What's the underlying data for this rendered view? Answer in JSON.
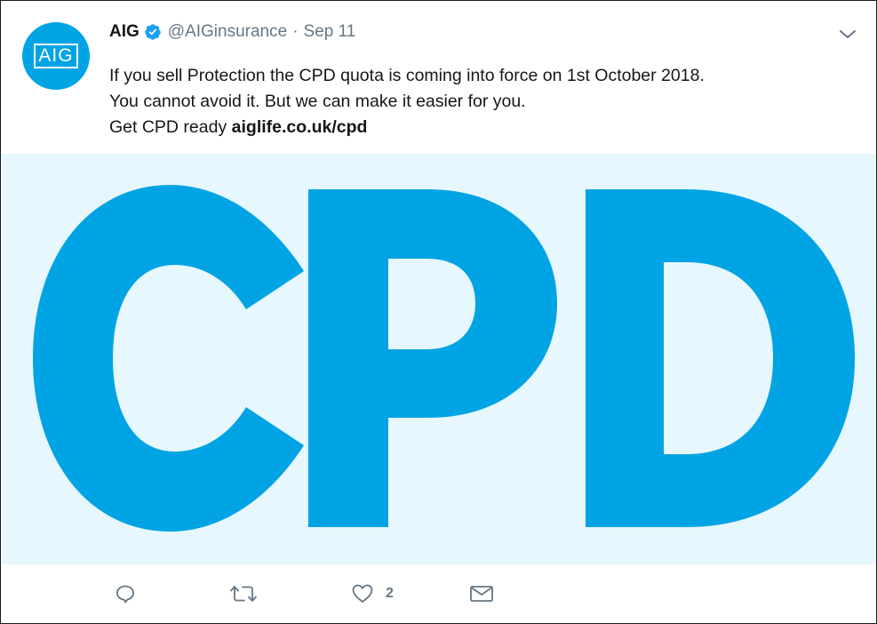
{
  "tweet": {
    "avatar": {
      "icon": "aig-logo",
      "text": "AIG",
      "bg_color": "#00a4e4"
    },
    "display_name": "AIG",
    "verified_icon": "verified-badge-icon",
    "handle": "@AIGinsurance",
    "separator": "·",
    "date": "Sep 11",
    "text_lines": [
      "If you sell Protection the CPD quota is coming into force on 1st October 2018.",
      "You cannot avoid it. But we can make it easier for you."
    ],
    "line3_prefix": "Get CPD ready ",
    "link": "aiglife.co.uk/cpd",
    "media": {
      "text": "CPD",
      "text_color": "#00a4e4",
      "bg_color": "#e6f7fd"
    },
    "actions": {
      "reply_icon": "reply-icon",
      "retweet_icon": "retweet-icon",
      "like_icon": "heart-icon",
      "like_count": "2",
      "dm_icon": "envelope-icon"
    },
    "caret_icon": "chevron-down-icon",
    "colors": {
      "text": "#14171a",
      "secondary": "#657786",
      "verified": "#1da1f2"
    }
  }
}
